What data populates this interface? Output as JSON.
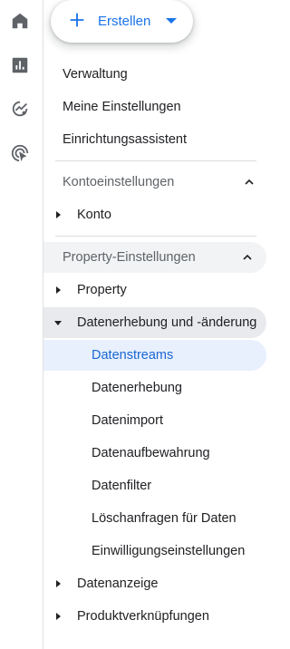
{
  "rail": {
    "icons": [
      "home-icon",
      "reports-icon",
      "explore-icon",
      "advertising-icon"
    ]
  },
  "create_button": {
    "label": "Erstellen"
  },
  "nav": {
    "admin": "Verwaltung",
    "my_settings": "Meine Einstellungen",
    "setup_assistant": "Einrichtungsassistent",
    "account_section": {
      "title": "Kontoeinstellungen",
      "items": [
        "Konto"
      ]
    },
    "property_section": {
      "title": "Property-Einstellungen",
      "property": "Property",
      "data_collection": {
        "title": "Datenerhebung und -änderung",
        "children": [
          "Datenstreams",
          "Datenerhebung",
          "Datenimport",
          "Datenaufbewahrung",
          "Datenfilter",
          "Löschanfragen für Daten",
          "Einwilligungseinstellungen"
        ]
      },
      "data_display": "Datenanzeige",
      "product_links": "Produktverknüpfungen"
    }
  },
  "colors": {
    "accent": "#1a73e8",
    "active_bg": "#e8f0fe",
    "active_text": "#1967d2"
  }
}
